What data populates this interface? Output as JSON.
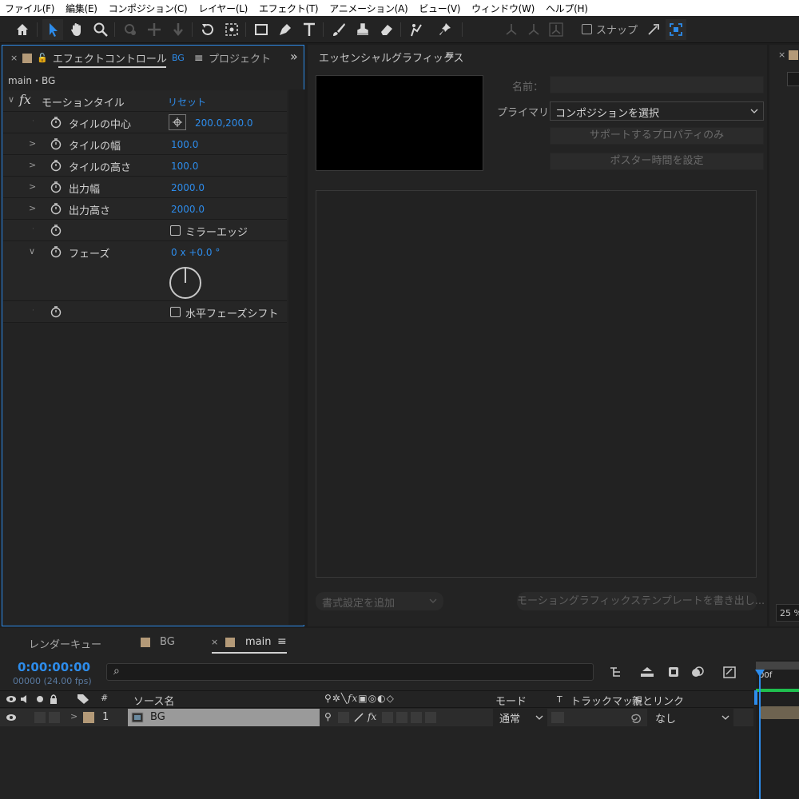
{
  "menu": [
    "ファイル(F)",
    "編集(E)",
    "コンポジション(C)",
    "レイヤー(L)",
    "エフェクト(T)",
    "アニメーション(A)",
    "ビュー(V)",
    "ウィンドウ(W)",
    "ヘルプ(H)"
  ],
  "toolbar": {
    "snap_label": "スナップ"
  },
  "effect_panel": {
    "tab_close": "×",
    "tab_label": "エフェクトコントロール",
    "tab_layer": "BG",
    "tab_menu": "≡",
    "tab2_label": "プロジェクト",
    "expand": "»",
    "breadcrumb": "main・BG",
    "effect_name": "モーションタイル",
    "reset": "リセット",
    "props": [
      {
        "label": "タイルの中心",
        "value": "200.0,200.0"
      },
      {
        "label": "タイルの幅",
        "value": "100.0"
      },
      {
        "label": "タイルの高さ",
        "value": "100.0"
      },
      {
        "label": "出力幅",
        "value": "2000.0"
      },
      {
        "label": "出力高さ",
        "value": "2000.0"
      },
      {
        "label": "",
        "value": "ミラーエッジ"
      },
      {
        "label": "フェーズ",
        "value": "0 x +0.0 °"
      },
      {
        "label": "",
        "value": "水平フェーズシフト"
      }
    ]
  },
  "eg_panel": {
    "title": "エッセンシャルグラフィックス",
    "menu": "≡",
    "name_label": "名前：",
    "primary_label": "プライマリ：",
    "primary_value": "コンポジションを選択",
    "supported_btn": "サポートするプロパティのみ",
    "poster_btn": "ポスター時間を設定",
    "add_format": "書式設定を追加",
    "export_btn": "モーショングラフィックステンプレートを書き出し..."
  },
  "right_panel": {
    "zoom": "25 %"
  },
  "timeline": {
    "tab_render": "レンダーキュー",
    "tab_bg": "BG",
    "tab_main_close": "×",
    "tab_main": "main",
    "tab_menu": "≡",
    "timecode": "0:00:00:00",
    "fps": "00000 (24.00 fps)",
    "search_icon": "⌕",
    "col_hash": "#",
    "col_source": "ソース名",
    "col_mode": "モード",
    "col_t": "T",
    "col_trackmatte": "トラックマット",
    "col_parent": "親とリンク",
    "ruler_label": "00f",
    "layer": {
      "index": "1",
      "name": "BG",
      "mode": "通常",
      "parent": "なし"
    }
  }
}
